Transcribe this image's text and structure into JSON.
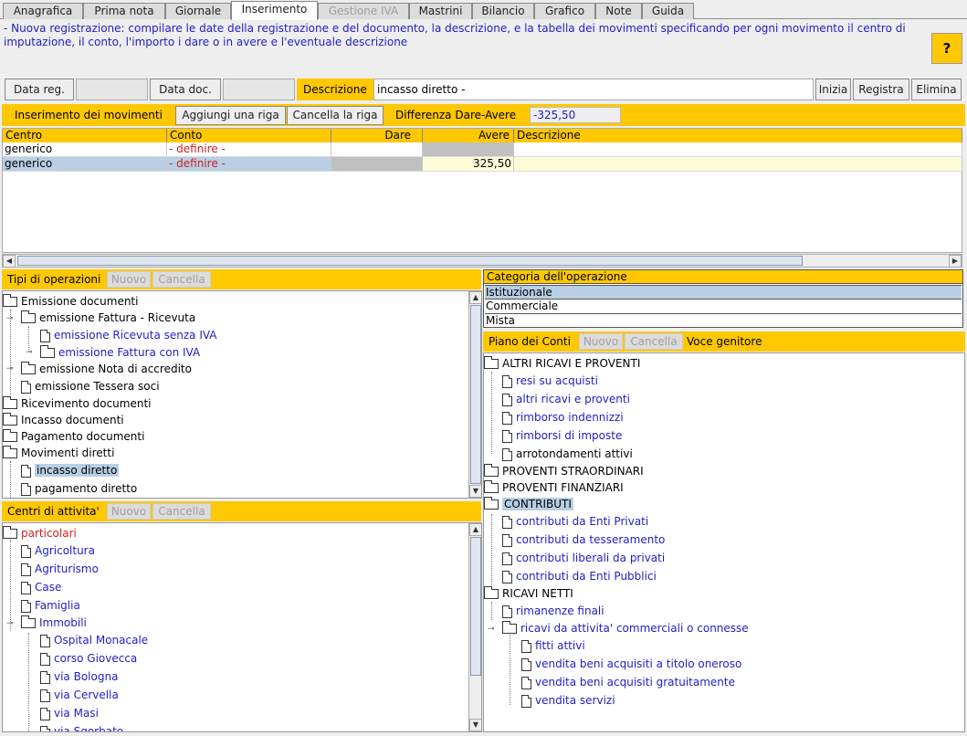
{
  "tabs": [
    "Anagrafica",
    "Prima nota",
    "Giornale",
    "Inserimento",
    "Gestione IVA",
    "Mastrini",
    "Bilancio",
    "Grafico",
    "Note",
    "Guida"
  ],
  "info": {
    "text": "- Nuova registrazione: compilare le date della registrazione e del documento, la descrizione, e la tabella dei movimenti specificando per ogni movimento il centro di imputazione, il conto, l'importo i dare o in avere e l'eventuale descrizione",
    "help": "?"
  },
  "header": {
    "data_reg": "Data reg.",
    "data_doc": "Data doc.",
    "descrizione_label": "Descrizione",
    "descrizione_value": "incasso diretto -",
    "inizia": "Inizia",
    "registra": "Registra",
    "elimina": "Elimina"
  },
  "movimenti": {
    "title": "Inserimento dei movimenti",
    "add": "Aggiungi una riga",
    "remove": "Cancella la riga",
    "diff_label": "Differenza Dare-Avere",
    "diff_value": "-325,50"
  },
  "table": {
    "columns": [
      "Centro",
      "Conto",
      "Dare",
      "Avere",
      "Descrizione"
    ],
    "rows": [
      {
        "centro": "generico",
        "conto": "- definire -",
        "dare": "",
        "avere": "",
        "descrizione": ""
      },
      {
        "centro": "generico",
        "conto": "- definire -",
        "dare": "",
        "avere": "325,50",
        "descrizione": ""
      }
    ]
  },
  "tipi": {
    "title": "Tipi di operazioni",
    "nuovo": "Nuovo",
    "cancella": "Cancella",
    "items": [
      "Emissione documenti",
      "emissione Fattura - Ricevuta",
      "emissione Ricevuta senza IVA",
      "emissione Fattura con IVA",
      "emissione Nota di accredito",
      "emissione Tessera soci",
      "Ricevimento documenti",
      "Incasso documenti",
      "Pagamento documenti",
      "Movimenti diretti",
      "incasso diretto",
      "pagamento diretto"
    ]
  },
  "centri": {
    "title": "Centri di attivita'",
    "nuovo": "Nuovo",
    "cancella": "Cancella",
    "items": [
      "particolari",
      "Agricoltura",
      "Agriturismo",
      "Case",
      "Famiglia",
      "Immobili",
      "Ospital Monacale",
      "corso Giovecca",
      "via Bologna",
      "via Cervella",
      "via Masi",
      "via Sgorbato"
    ]
  },
  "categoria": {
    "title": "Categoria dell'operazione",
    "items": [
      "Istituzionale",
      "Commerciale",
      "Mista"
    ]
  },
  "piano": {
    "title": "Piano dei Conti",
    "nuovo": "Nuovo",
    "cancella": "Cancella",
    "genitore": "Voce genitore",
    "items": [
      "ALTRI RICAVI E PROVENTI",
      "resi su acquisti",
      "altri ricavi e proventi",
      "rimborso indennizzi",
      "rimborsi di imposte",
      "arrotondamenti attivi",
      "PROVENTI STRAORDINARI",
      "PROVENTI FINANZIARI",
      "CONTRIBUTI",
      "contributi da Enti Privati",
      "contributi da tesseramento",
      "contributi liberali da privati",
      "contributi da Enti Pubblici",
      "RICAVI NETTI",
      "rimanenze finali",
      "ricavi da attivita' commerciali o connesse",
      "fitti attivi",
      "vendita beni acquisiti a titolo oneroso",
      "vendita beni acquisiti gratuitamente",
      "vendita servizi"
    ]
  },
  "colors": {
    "accent": "#ffc800",
    "link": "#1e1ec8",
    "warning": "#d21e1e",
    "selection": "#b8cfe5"
  }
}
